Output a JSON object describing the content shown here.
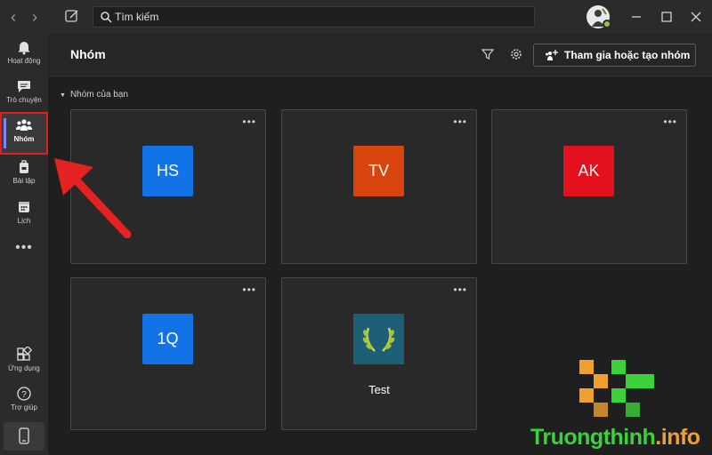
{
  "titlebar": {
    "back_icon": "chevron-left-icon",
    "forward_icon": "chevron-right-icon",
    "compose_icon": "compose-icon",
    "search_placeholder": "Tìm kiếm",
    "window_buttons": [
      "minimize-icon",
      "maximize-icon",
      "close-icon"
    ]
  },
  "rail": {
    "items": [
      {
        "label": "Hoạt động",
        "icon": "bell-icon"
      },
      {
        "label": "Trò chuyện",
        "icon": "chat-icon"
      },
      {
        "label": "Nhóm",
        "icon": "teams-icon",
        "active": true
      },
      {
        "label": "Bài tập",
        "icon": "backpack-icon"
      },
      {
        "label": "Lịch",
        "icon": "calendar-icon"
      }
    ],
    "more": "•••",
    "bottom_items": [
      {
        "label": "Ứng dụng",
        "icon": "apps-icon"
      },
      {
        "label": "Trợ giúp",
        "icon": "help-icon"
      }
    ],
    "mobile_icon": "mobile-icon",
    "accent": "#7f85f5",
    "highlight": "#e02020"
  },
  "header": {
    "title": "Nhóm",
    "filter_icon": "filter-icon",
    "settings_icon": "gear-icon",
    "join_button": "Tham gia hoặc tạo nhóm"
  },
  "section": {
    "title": "Nhóm của bạn"
  },
  "teams": [
    {
      "initials": "HS",
      "color": "#1173e6",
      "name": ""
    },
    {
      "initials": "TV",
      "color": "#d8440e",
      "name": ""
    },
    {
      "initials": "AK",
      "color": "#e3101e",
      "name": ""
    },
    {
      "initials": "1Q",
      "color": "#1173e6",
      "name": ""
    },
    {
      "initials": "",
      "color": "#1e5f78",
      "name": "Test",
      "icon": "laurel-icon"
    }
  ],
  "card_more": "•••",
  "watermark": {
    "text_green": "Truongthinh",
    "text_orange": ".info"
  }
}
